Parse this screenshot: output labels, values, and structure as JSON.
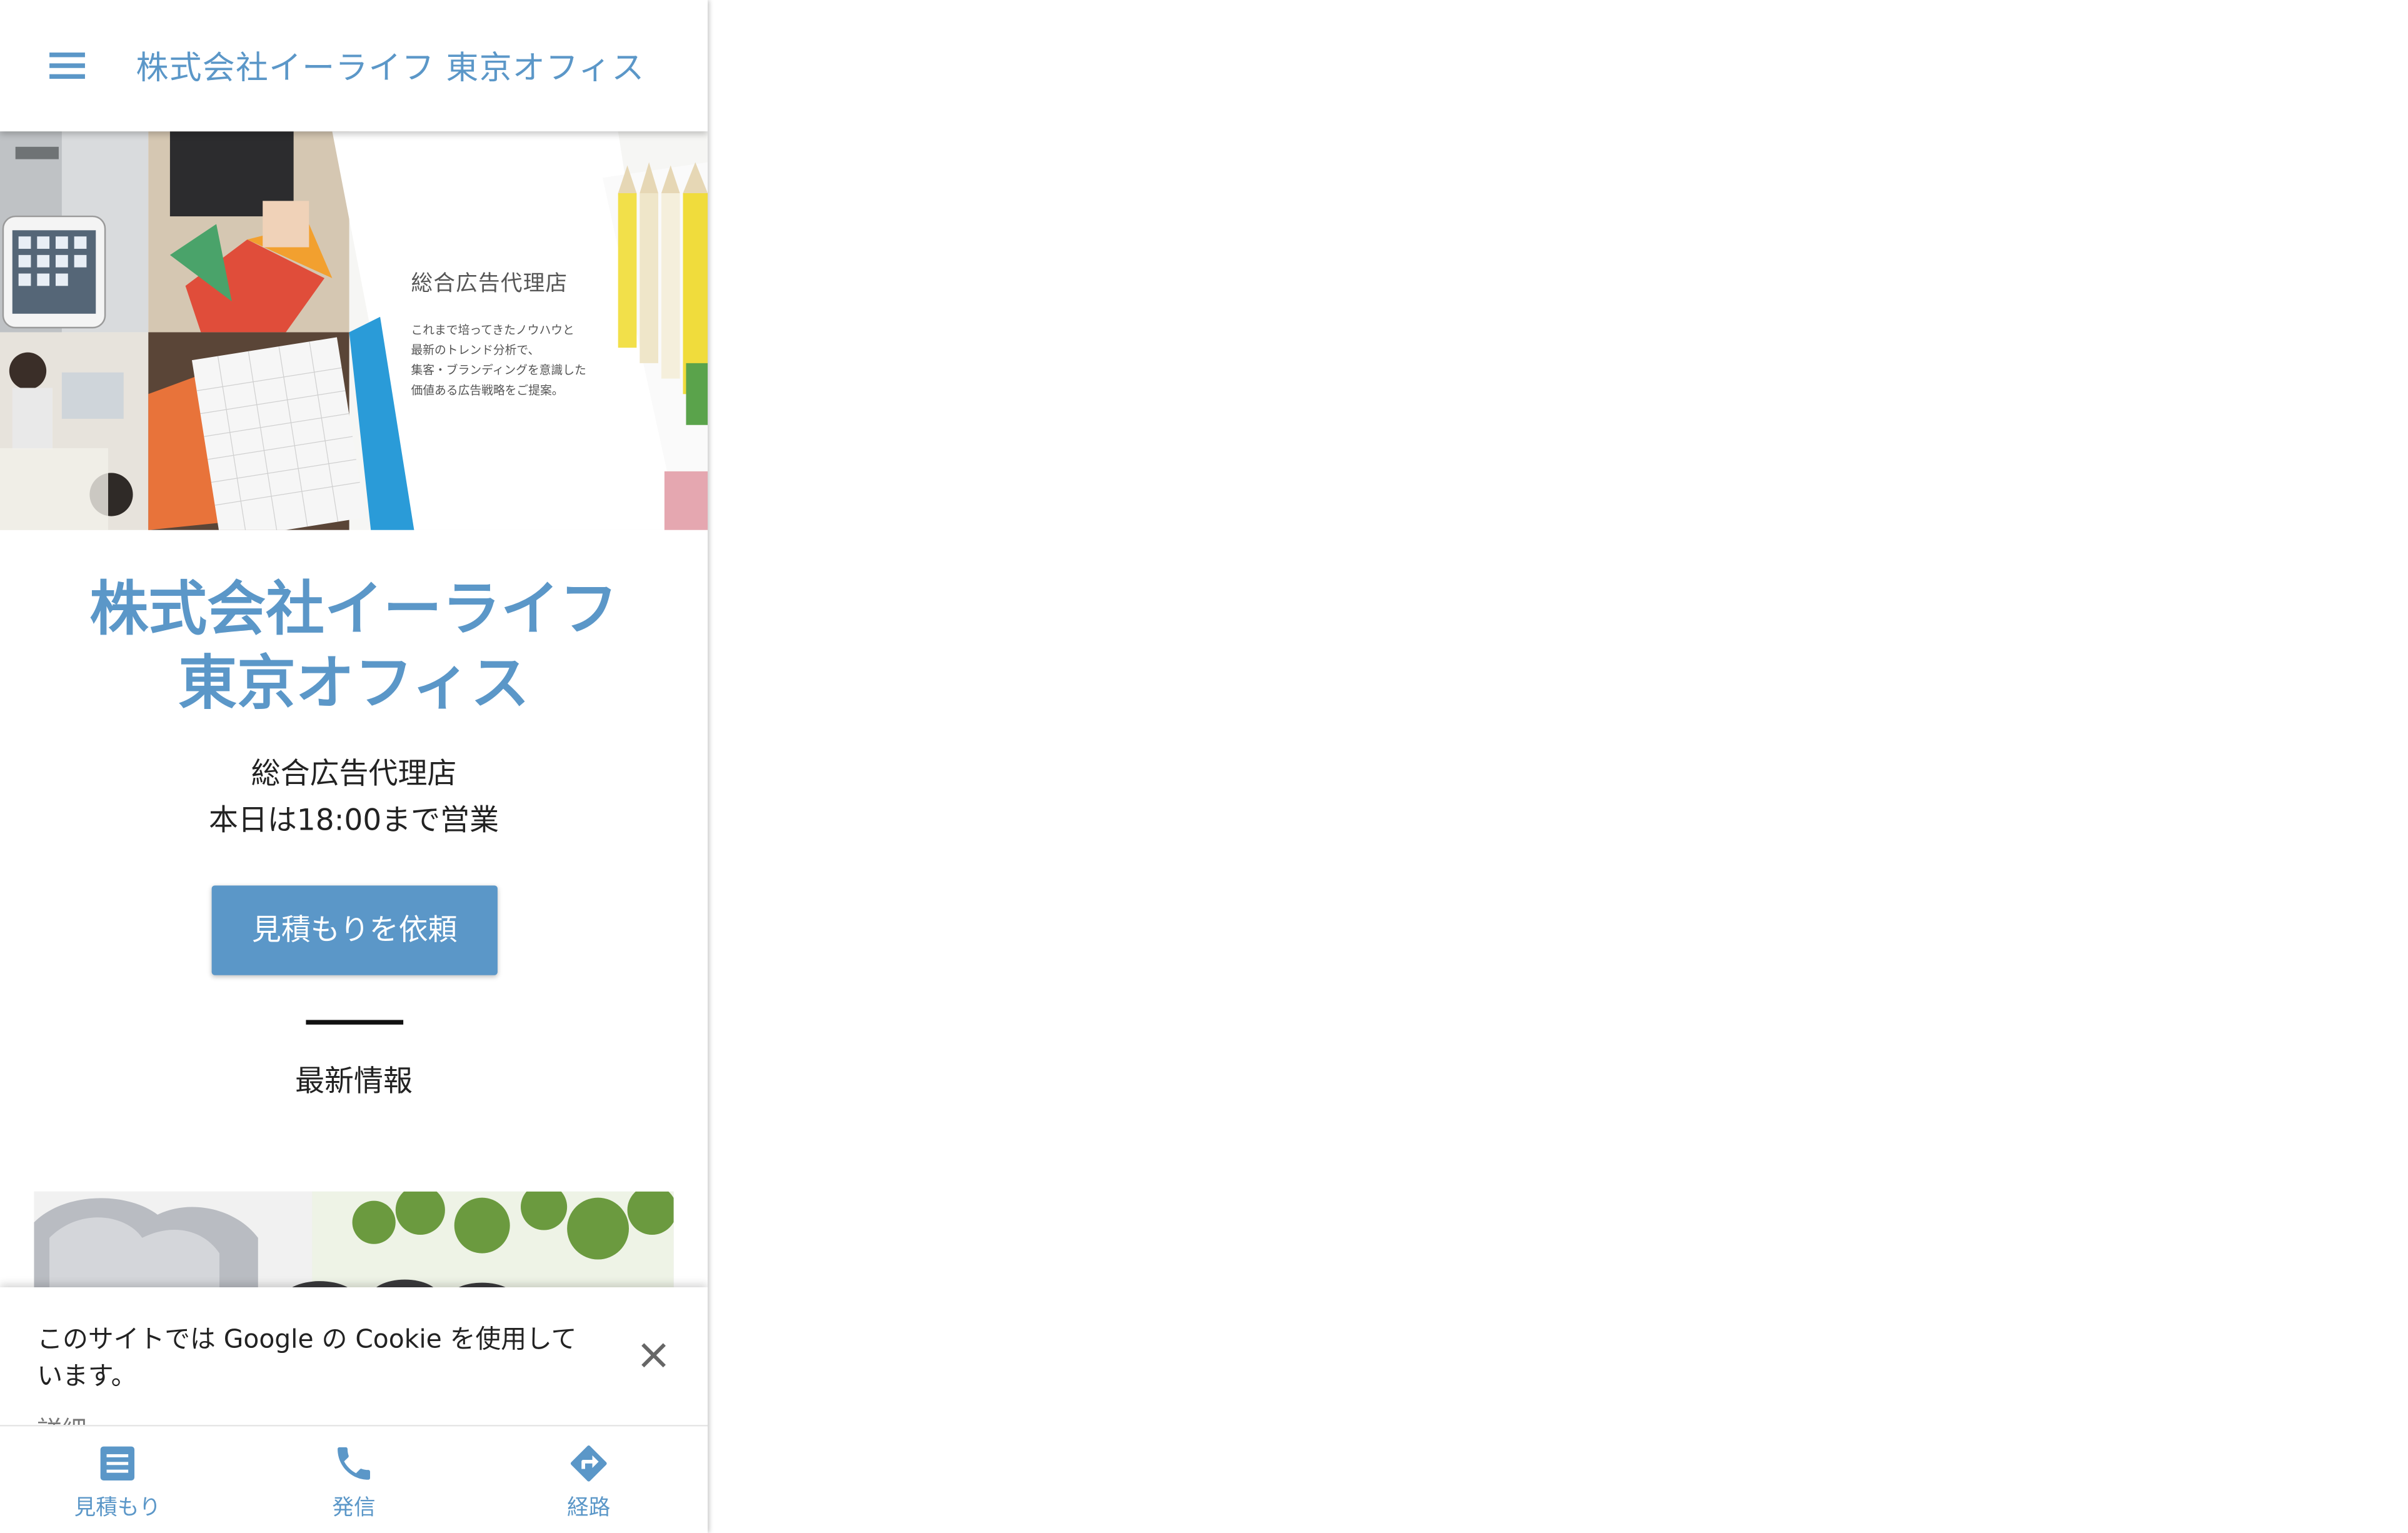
{
  "appbar": {
    "title": "株式会社イーライフ 東京オフィス",
    "menu_icon": "hamburger-menu-icon"
  },
  "hero": {
    "heading": "総合広告代理店",
    "body": "これまで培ってきたノウハウと\n最新のトレンド分析で、\n集客・ブランディングを意識した\n価値ある広告戦略をご提案。"
  },
  "business": {
    "name": "株式会社イーライフ\n東京オフィス",
    "category": "総合広告代理店",
    "hours": "本日は18:00まで営業"
  },
  "cta": {
    "quote_label": "見積もりを依頼"
  },
  "news": {
    "heading": "最新情報"
  },
  "cookie_banner": {
    "text": "このサイトでは Google の Cookie を使用しています。",
    "more_label": "詳細",
    "close_icon": "close-icon"
  },
  "bottom_nav": {
    "items": [
      {
        "label": "見積もり",
        "icon": "quote-icon"
      },
      {
        "label": "発信",
        "icon": "phone-icon"
      },
      {
        "label": "経路",
        "icon": "directions-icon"
      }
    ]
  },
  "colors": {
    "accent": "#5b97c8",
    "text": "#222222",
    "background": "#ffffff"
  }
}
